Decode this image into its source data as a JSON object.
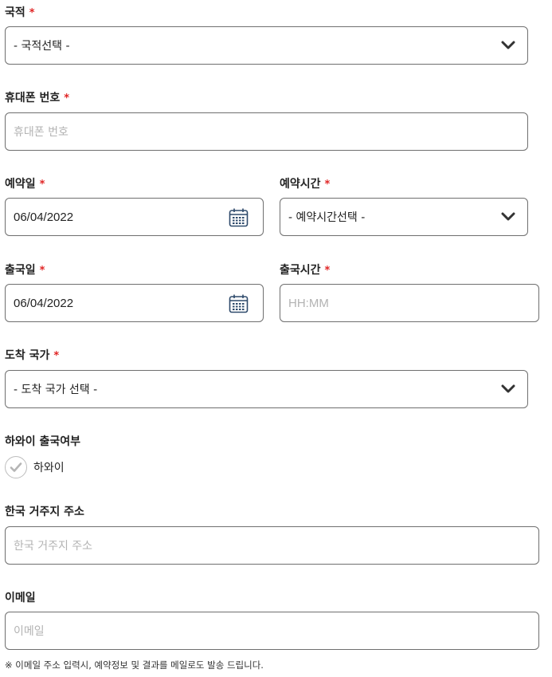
{
  "nationality": {
    "label": "국적",
    "required": "*",
    "selected": "- 국적선택 -"
  },
  "phone": {
    "label": "휴대폰 번호",
    "required": "*",
    "placeholder": "휴대폰 번호"
  },
  "reservation_date": {
    "label": "예약일",
    "required": "*",
    "value": "06/04/2022"
  },
  "reservation_time": {
    "label": "예약시간",
    "required": "*",
    "selected": "- 예약시간선택 -"
  },
  "departure_date": {
    "label": "출국일",
    "required": "*",
    "value": "06/04/2022"
  },
  "departure_time": {
    "label": "출국시간",
    "required": "*",
    "placeholder": "HH:MM"
  },
  "destination": {
    "label": "도착 국가",
    "required": "*",
    "selected": "- 도착 국가 선택 -"
  },
  "hawaii": {
    "label": "하와이 출국여부",
    "option_label": "하와이"
  },
  "korea_address": {
    "label": "한국 거주지 주소",
    "placeholder": "한국 거주지 주소"
  },
  "email": {
    "label": "이메일",
    "placeholder": "이메일"
  },
  "note": "※ 이메일 주소 입력시, 예약정보 및 결과를 메일로도 발송 드립니다.",
  "colors": {
    "required": "#e02424",
    "border": "#6f6f6f",
    "placeholder": "#b3b3b3"
  },
  "icons": {
    "select": "chevron-down-icon",
    "date": "calendar-icon",
    "check": "check-icon"
  }
}
